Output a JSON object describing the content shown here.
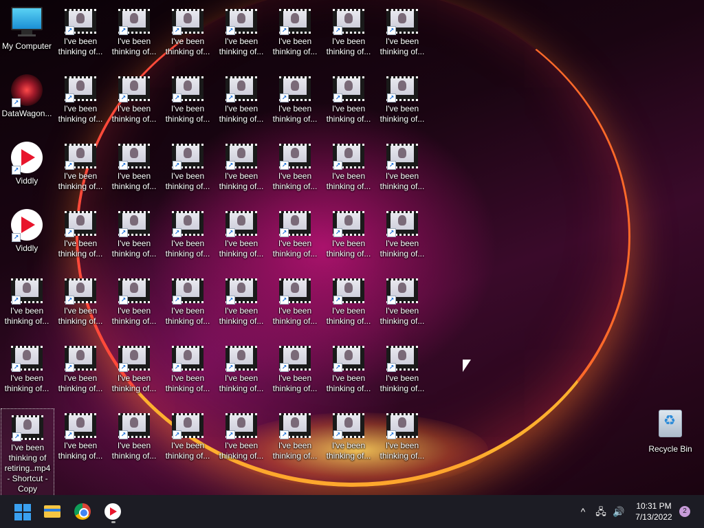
{
  "desktop": {
    "system_icons": [
      {
        "id": "my-computer",
        "label": "My Computer"
      },
      {
        "id": "datawagon",
        "label": "DataWagon..."
      },
      {
        "id": "viddly-1",
        "label": "Viddly"
      },
      {
        "id": "viddly-2",
        "label": "Viddly"
      }
    ],
    "video_shortcut_label_line1": "I've been",
    "video_shortcut_label_line2": "thinking of...",
    "selected_icon": {
      "label_lines": [
        "I've been",
        "thinking of",
        "retiring..mp4",
        "- Shortcut -",
        "Copy"
      ]
    },
    "recycle_bin": {
      "label": "Recycle Bin"
    }
  },
  "taskbar": {
    "pinned": [
      {
        "icon": "windows-start-icon"
      },
      {
        "icon": "file-explorer-icon"
      },
      {
        "icon": "chrome-icon"
      },
      {
        "icon": "viddly-icon"
      }
    ],
    "tray": {
      "chevron": "^",
      "network": "🖧",
      "volume": "🔊",
      "time": "10:31 PM",
      "date": "7/13/2022",
      "notifications": "2"
    }
  }
}
